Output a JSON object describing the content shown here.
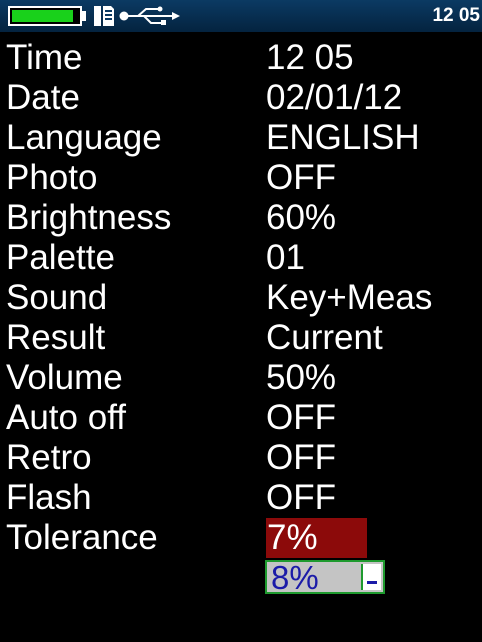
{
  "status": {
    "battery_level": 0.92,
    "battery_icon": "battery-icon",
    "storage_icon": "sd-card-icon",
    "connection_icon": "usb-icon",
    "clock": "12 05",
    "colors": {
      "bar": "#0b3a63",
      "battery": "#19d11b"
    }
  },
  "settings": [
    {
      "label": "Time",
      "value": "12 05"
    },
    {
      "label": "Date",
      "value": "02/01/12"
    },
    {
      "label": "Language",
      "value": "ENGLISH"
    },
    {
      "label": "Photo",
      "value": "OFF"
    },
    {
      "label": "Brightness",
      "value": "60%"
    },
    {
      "label": "Palette",
      "value": "01"
    },
    {
      "label": "Sound",
      "value": "Key+Meas"
    },
    {
      "label": "Result",
      "value": "Current"
    },
    {
      "label": "Volume",
      "value": "50%"
    },
    {
      "label": "Auto off",
      "value": "OFF"
    },
    {
      "label": "Retro",
      "value": "OFF"
    },
    {
      "label": "Flash",
      "value": "OFF"
    },
    {
      "label": "Tolerance",
      "value": "7%"
    }
  ],
  "editor": {
    "value": "8%",
    "sign_icon": "minus-icon",
    "colors": {
      "selected_value_bg": "#8c0a0a",
      "editor_bg": "#c4c4c4",
      "editor_border": "#1e9a2e",
      "editor_text": "#1b1ba8"
    }
  }
}
